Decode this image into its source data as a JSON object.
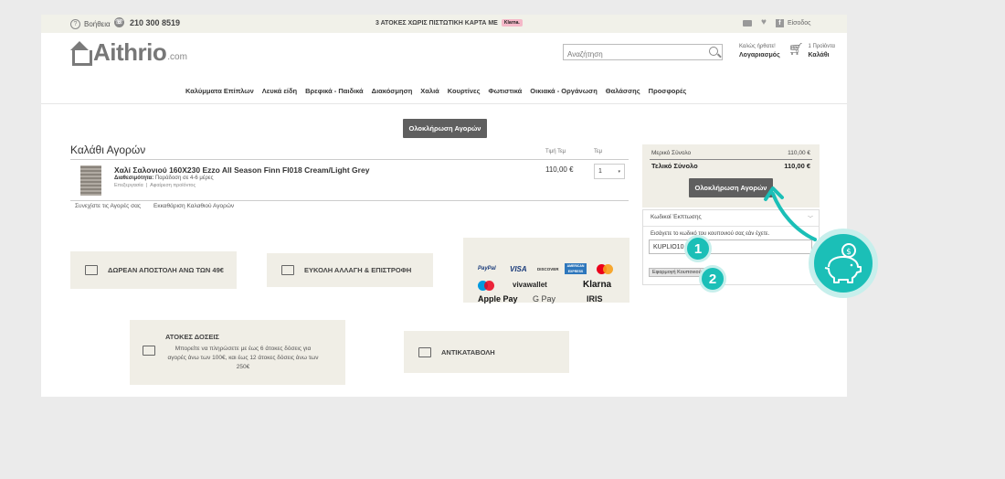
{
  "topbar": {
    "help_label": "Βοήθεια",
    "phone": "210 300 8519",
    "promo_text": "3 ΑΤΟΚΕΣ ΧΩΡΙΣ ΠΙΣΤΩΤΙΚΗ ΚΑΡΤΑ ΜΕ",
    "promo_badge": "Klarna.",
    "login_label": "Είσοδος"
  },
  "header": {
    "logo_text": "Aithrio",
    "logo_suffix": ".com",
    "search_placeholder": "Αναζήτηση",
    "account_greeting": "Καλώς ήρθατε!",
    "account_label": "Λογαριασμός",
    "cart_count": "1 Προϊόντα",
    "cart_label": "Καλάθι"
  },
  "nav": [
    "Καλύμματα Επίπλων",
    "Λευκά είδη",
    "Βρεφικά - Παιδικά",
    "Διακόσμηση",
    "Χαλιά",
    "Κουρτίνες",
    "Φωτιστικά",
    "Οικιακά - Οργάνωση",
    "Θαλάσσης",
    "Προσφορές"
  ],
  "checkout_label": "Ολοκλήρωση Αγορών",
  "cart": {
    "title": "Καλάθι Αγορών",
    "col_price": "Τιμή Τεμ",
    "col_qty": "Τεμ",
    "item": {
      "name": "Χαλί Σαλονιού 160X230 Ezzo All Season Finn Fl018 Cream/Light Grey",
      "availability_label": "Διαθεσιμότητα:",
      "availability_value": "Παράδοση σε 4-6 μέρες",
      "edit_label": "Επεξεργασία",
      "remove_label": "Αφαίρεση προϊόντος",
      "price": "110,00 €",
      "qty": "1"
    },
    "continue_label": "Συνεχίστε τις Αγορές σας",
    "clear_label": "Εκκαθάριση Καλαθιού Αγορών"
  },
  "features": {
    "shipping": "ΔΩΡΕΑΝ ΑΠΟΣΤΟΛΗ ΑΝΩ ΤΩΝ 49€",
    "returns": "ΕΥΚΟΛΗ ΑΛΛΑΓΗ & ΕΠΙΣΤΡΟΦΗ",
    "installments_title": "ΑΤΟΚΕΣ ΔΟΣΕΙΣ",
    "installments_desc": "Μπορείτε να πληρώσετε με έως 6 άτοκες δόσεις για αγορές άνω των 100€, και έως 12 άτοκες δόσεις άνω των 250€",
    "cod": "ΑΝΤΙΚΑΤΑΒΟΛΗ"
  },
  "payments": [
    "PayPal",
    "VISA",
    "DISCOVER",
    "AMERICAN EXPRESS",
    "mastercard",
    "Maestro",
    "vivawallet",
    "Klarna",
    "Apple Pay",
    "G Pay",
    "IRIS"
  ],
  "summary": {
    "subtotal_label": "Μερικό Σύνολο",
    "subtotal_value": "110,00 €",
    "total_label": "Τελικό Σύνολο",
    "total_value": "110,00 €"
  },
  "coupon": {
    "header": "Κωδικοί Έκπτωσης",
    "hint": "Εισάγετε το κωδικό του κουπονιού σας εάν έχετε.",
    "value": "KUPLIO10",
    "apply_label": "Εφαρμογή Κουπονιού"
  },
  "steps": [
    "1",
    "2"
  ],
  "colors": {
    "accent": "#1bbfb7",
    "button": "#5f5f5f",
    "panel": "#f0eee6"
  }
}
